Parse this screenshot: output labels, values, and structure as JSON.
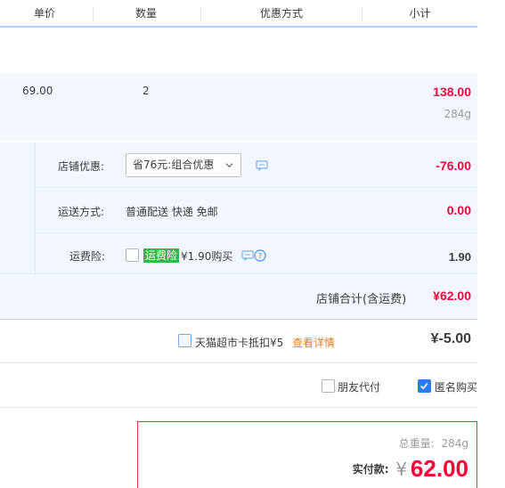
{
  "header": {
    "col_price": "单价",
    "col_qty": "数量",
    "col_promo": "优惠方式",
    "col_subtotal": "小计"
  },
  "item": {
    "unit_price": "69.00",
    "quantity": "2",
    "subtotal": "138.00",
    "weight": "284g"
  },
  "shop_promo": {
    "label": "店铺优惠:",
    "selected_option": "省76元:组合优惠",
    "amount": "-76.00"
  },
  "shipping": {
    "label": "运送方式:",
    "value": "普通配送 快递 免邮",
    "amount": "0.00"
  },
  "insurance": {
    "label": "运费险:",
    "tag": "运费险",
    "price_text": "¥1.90购买",
    "amount": "1.90"
  },
  "shop_total": {
    "label": "店铺合计(含运费)",
    "amount": "¥62.00"
  },
  "tmall_card": {
    "label": "天猫超市卡抵扣¥5",
    "link": "查看详情",
    "amount": "¥-5.00"
  },
  "options": {
    "friend_pay": "朋友代付",
    "anonymous": "匿名购买",
    "anonymous_checked": true,
    "friend_pay_checked": false
  },
  "payment": {
    "weight_label": "总重量:",
    "weight_value": "284g",
    "actual_label": "实付款:",
    "currency": "¥",
    "amount": "62.00"
  },
  "colors": {
    "accent_red": "#ff0036",
    "link_orange": "#e4393c",
    "check_blue": "#2c7ce6",
    "tag_green": "#3bb34a",
    "row_blue": "#f2f7ff"
  },
  "icons": [
    "chevron-down-icon",
    "chat-icon",
    "question-icon",
    "checkmark-icon"
  ]
}
